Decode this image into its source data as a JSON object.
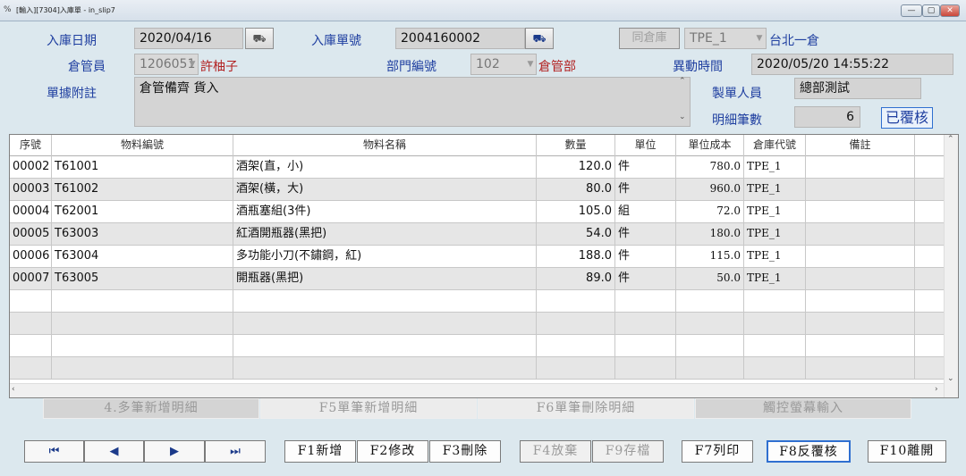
{
  "window": {
    "title": "[輸入][7304]入庫單 - in_slip7",
    "minimize_symbol": "—",
    "restore_symbol": "▢",
    "close_symbol": "✕"
  },
  "header": {
    "date_label": "入庫日期",
    "date_value": "2020/04/16",
    "slip_no_label": "入庫單號",
    "slip_no_value": "2004160002",
    "same_warehouse_button": "同倉庫",
    "warehouse_code": "TPE_1",
    "warehouse_name": "台北一倉",
    "keeper_label": "倉管員",
    "keeper_id": "1206051",
    "keeper_name": "許柚子",
    "dept_label": "部門編號",
    "dept_code": "102",
    "dept_name": "倉管部",
    "change_time_label": "異動時間",
    "change_time_value": "2020/05/20 14:55:22",
    "note_label": "單據附註",
    "note_value": "倉管備齊 貨入",
    "maker_label": "製單人員",
    "maker_value": "總部測試",
    "detail_count_label": "明細筆數",
    "detail_count_value": "6",
    "status_badge": "已覆核",
    "lookup_icon_glyph": "⛟"
  },
  "grid": {
    "columns": [
      "序號",
      "物料編號",
      "物料名稱",
      "數量",
      "單位",
      "單位成本",
      "倉庫代號",
      "備註"
    ],
    "rows": [
      {
        "seq": "00002",
        "code": "T61001",
        "name": "酒架(直，小)",
        "qty": "120.0",
        "unit": "件",
        "cost": "780.0",
        "wh": "TPE_1",
        "memo": ""
      },
      {
        "seq": "00003",
        "code": "T61002",
        "name": "酒架(橫，大)",
        "qty": "80.0",
        "unit": "件",
        "cost": "960.0",
        "wh": "TPE_1",
        "memo": ""
      },
      {
        "seq": "00004",
        "code": "T62001",
        "name": "酒瓶塞組(3件)",
        "qty": "105.0",
        "unit": "組",
        "cost": "72.0",
        "wh": "TPE_1",
        "memo": ""
      },
      {
        "seq": "00005",
        "code": "T63003",
        "name": "紅酒開瓶器(黑把)",
        "qty": "54.0",
        "unit": "件",
        "cost": "180.0",
        "wh": "TPE_1",
        "memo": ""
      },
      {
        "seq": "00006",
        "code": "T63004",
        "name": "多功能小刀(不鏽鋼，紅)",
        "qty": "188.0",
        "unit": "件",
        "cost": "115.0",
        "wh": "TPE_1",
        "memo": ""
      },
      {
        "seq": "00007",
        "code": "T63005",
        "name": "開瓶器(黑把)",
        "qty": "89.0",
        "unit": "件",
        "cost": "50.0",
        "wh": "TPE_1",
        "memo": ""
      }
    ]
  },
  "detail_buttons": {
    "multi_add": "4.多筆新增明細",
    "single_add": "F5單筆新增明細",
    "single_delete": "F6單筆刪除明細",
    "touch_input": "觸控螢幕輸入"
  },
  "toolbar": {
    "first": "⏮",
    "prev": "◀",
    "next": "▶",
    "last": "⏭",
    "add": "F1新增",
    "edit": "F2修改",
    "delete": "F3刪除",
    "discard": "F4放棄",
    "save": "F9存檔",
    "print": "F7列印",
    "unreview": "F8反覆核",
    "exit": "F10離開"
  },
  "colors": {
    "background": "#dce8ee",
    "label_blue": "#1f3fa0",
    "name_red": "#b22020",
    "focus_blue": "#2f6fd0"
  }
}
